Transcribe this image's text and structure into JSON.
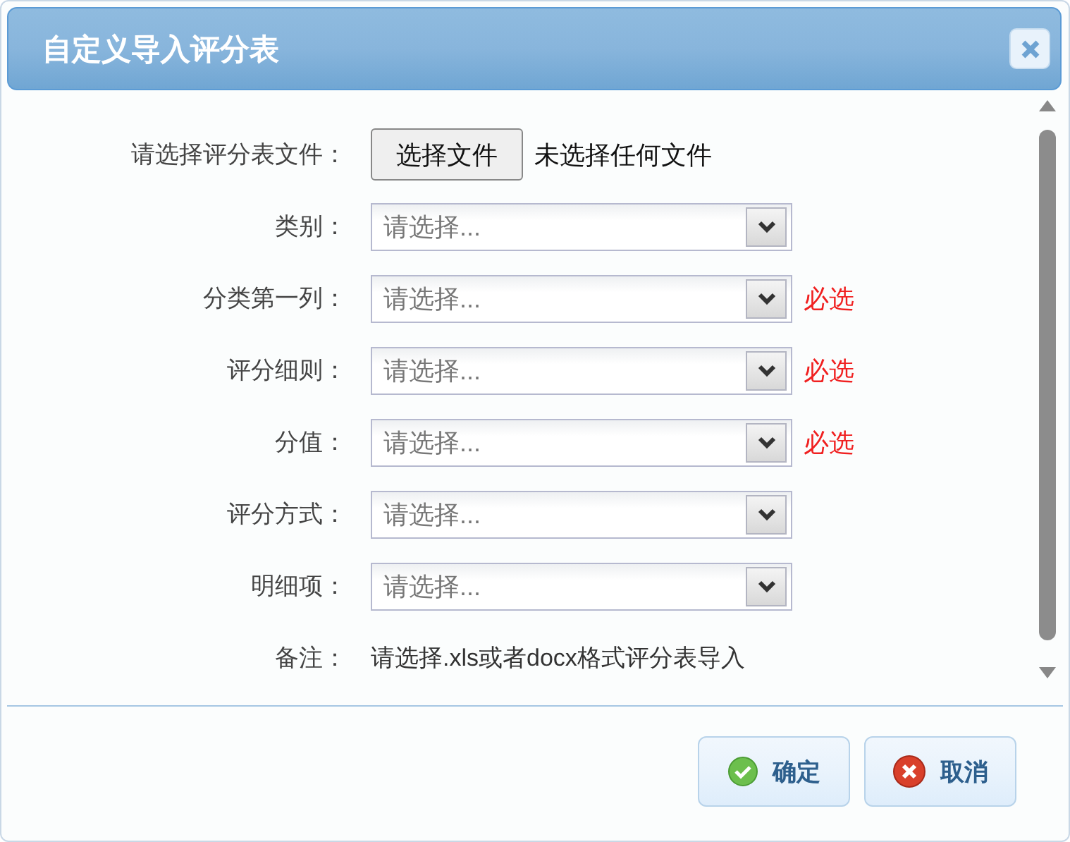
{
  "window": {
    "title": "自定义导入评分表"
  },
  "rows": [
    {
      "kind": "file",
      "label": "请选择评分表文件：",
      "button": "选择文件",
      "status": "未选择任何文件"
    },
    {
      "kind": "select",
      "label": "类别：",
      "placeholder": "请选择..."
    },
    {
      "kind": "select",
      "label": "分类第一列：",
      "placeholder": "请选择...",
      "required": "必选"
    },
    {
      "kind": "select",
      "label": "评分细则：",
      "placeholder": "请选择...",
      "required": "必选"
    },
    {
      "kind": "select",
      "label": "分值：",
      "placeholder": "请选择...",
      "required": "必选"
    },
    {
      "kind": "select",
      "label": "评分方式：",
      "placeholder": "请选择..."
    },
    {
      "kind": "select",
      "label": "明细项：",
      "placeholder": "请选择..."
    },
    {
      "kind": "note",
      "label": "备注：",
      "text": "请选择.xls或者docx格式评分表导入"
    }
  ],
  "buttons": [
    {
      "kind": "ok",
      "label": "确定"
    },
    {
      "kind": "cancel",
      "label": "取消"
    }
  ]
}
